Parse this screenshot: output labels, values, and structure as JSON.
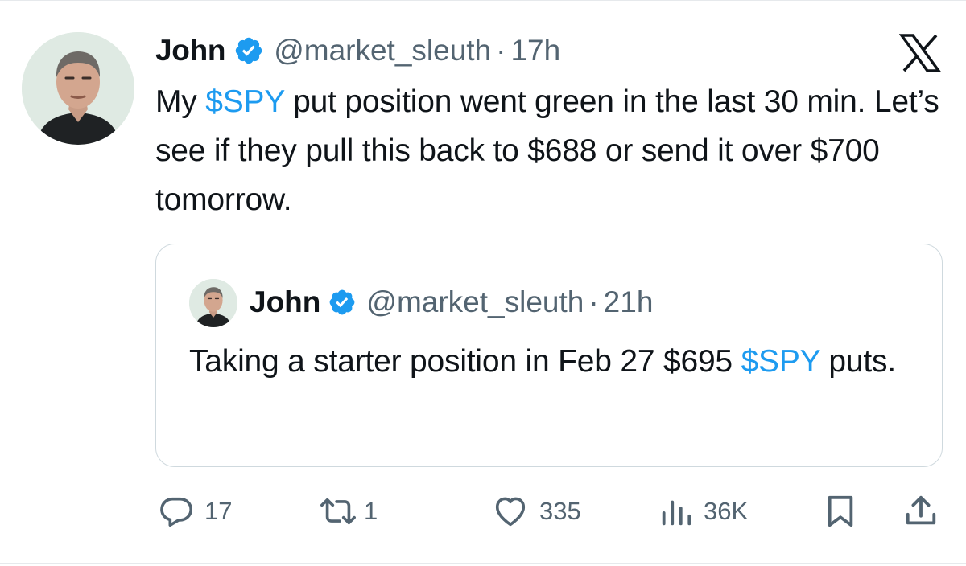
{
  "tweet": {
    "author_name": "John",
    "handle": "@market_sleuth",
    "separator": "·",
    "time": "17h",
    "text_parts": {
      "before": "My ",
      "cashtag": "$SPY",
      "after": " put position went green in the last 30 min. Let’s see if they pull this back to $688 or send it over $700 tomorrow."
    }
  },
  "quoted_tweet": {
    "author_name": "John",
    "handle": "@market_sleuth",
    "separator": "·",
    "time": "21h",
    "text_parts": {
      "before": "Taking a starter position in Feb 27 $695 ",
      "cashtag": "$SPY",
      "after": " puts."
    }
  },
  "actions": {
    "replies": "17",
    "reposts": "1",
    "likes": "335",
    "views": "36K"
  },
  "icons": {
    "verified": "verified-badge-icon",
    "platform": "x-logo-icon",
    "reply": "reply-bubble-icon",
    "repost": "repost-arrows-icon",
    "like": "heart-icon",
    "views": "bar-chart-icon",
    "bookmark": "bookmark-icon",
    "share": "share-upload-icon"
  },
  "colors": {
    "text": "#0f1419",
    "secondary": "#536471",
    "accent": "#1d9bf0",
    "border": "#cfd9de"
  }
}
